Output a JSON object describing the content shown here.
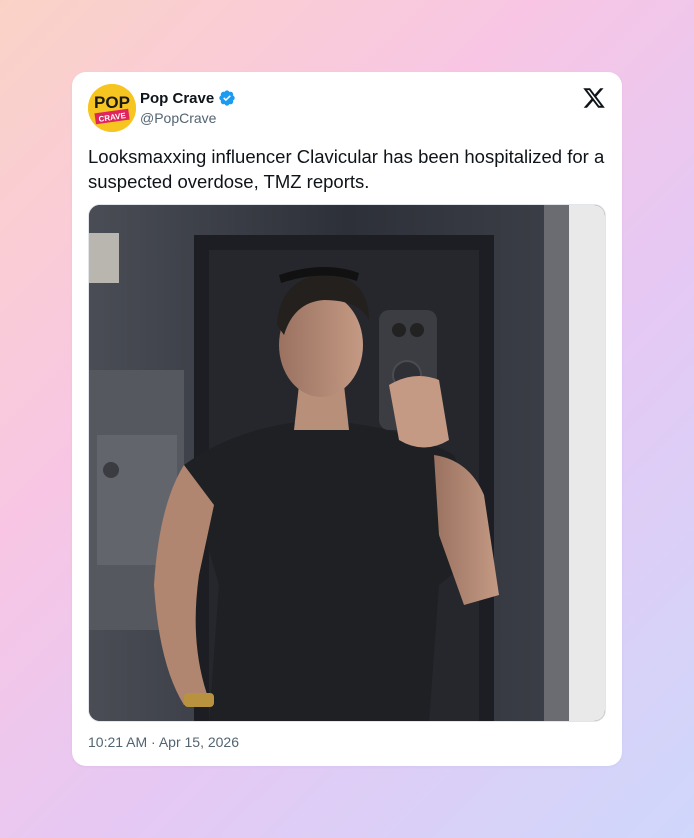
{
  "account": {
    "display_name": "Pop Crave",
    "handle": "@PopCrave",
    "verified": true,
    "avatar_text_line1": "POP",
    "avatar_text_line2": "CRAVE"
  },
  "tweet": {
    "text": "Looksmaxxing influencer Clavicular has been hospitalized for a suspected overdose, TMZ reports.",
    "timestamp": "10:21 AM · Apr 15, 2026"
  },
  "icons": {
    "platform": "x-logo-icon",
    "verified": "verified-badge-icon"
  },
  "colors": {
    "verified_blue": "#1d9bf0",
    "text_primary": "#0f1419",
    "text_secondary": "#536471",
    "avatar_bg": "#f7c520",
    "avatar_accent": "#e0245e"
  }
}
